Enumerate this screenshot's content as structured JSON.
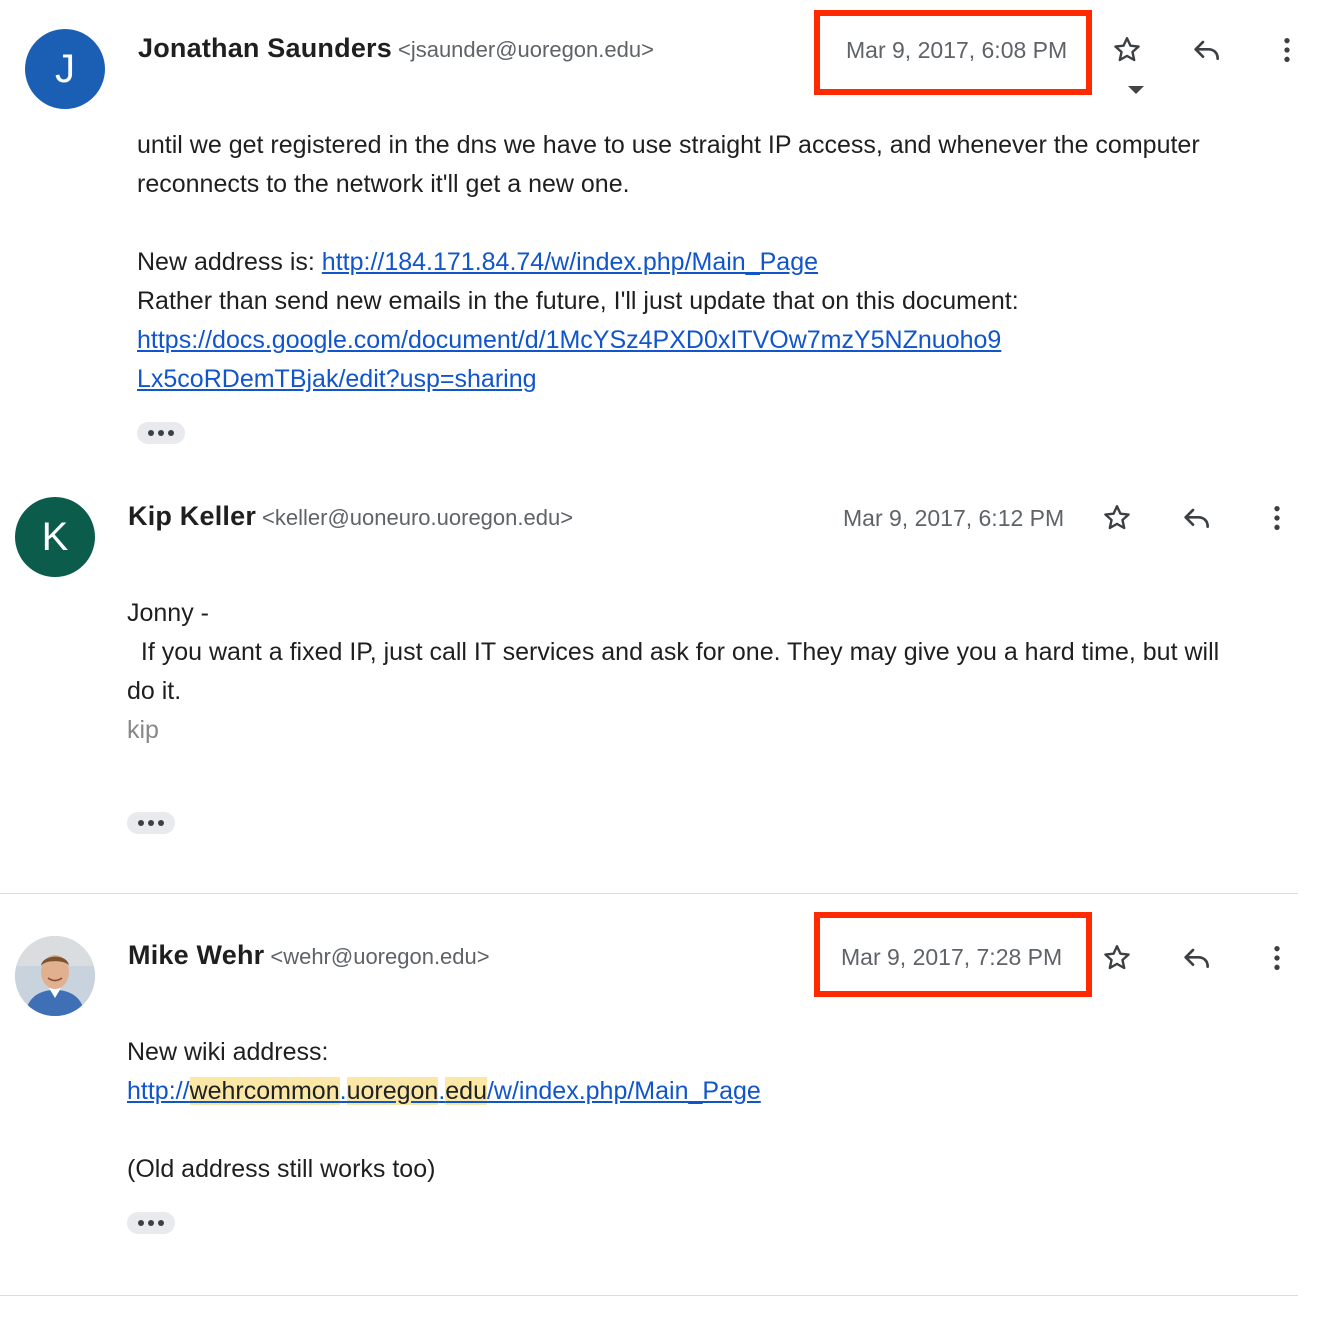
{
  "messages": [
    {
      "avatar_letter": "J",
      "avatar_color": "#1a5fb4",
      "sender_name": "Jonathan Saunders",
      "sender_email": "<jsaunder@uoregon.edu>",
      "date": "Mar 9, 2017, 6:08 PM",
      "date_highlighted": true,
      "body": {
        "line1": "until we get registered in the dns we have to use straight IP access, and whenever the computer",
        "line2": "reconnects to the network it'll get a new one.",
        "new_address_label": "New address is: ",
        "new_address_link": "http://184.171.84.74/w/index.php/Main_Page",
        "line4": "Rather than send new emails in the future, I'll just update that on this document:",
        "doc_link_part1": "https://docs.google.com/document/d/1McYSz4PXD0xITVOw7mzY5NZnuoho9",
        "doc_link_part2": "Lx5coRDemTBjak/edit?usp=sharing"
      }
    },
    {
      "avatar_letter": "K",
      "avatar_color": "#0b5c4a",
      "sender_name": "Kip Keller",
      "sender_email": "<keller@uoneuro.uoregon.edu>",
      "date": "Mar 9, 2017, 6:12 PM",
      "date_highlighted": false,
      "body": {
        "greeting": "Jonny -",
        "line2": "  If you want a fixed IP, just call IT services and ask for one. They may give you a hard time, but will",
        "line3": "do it.",
        "signature": "kip"
      }
    },
    {
      "avatar_icon": "user-photo",
      "sender_name": "Mike Wehr",
      "sender_email": "<wehr@uoregon.edu>",
      "date": "Mar 9, 2017, 7:28 PM",
      "date_highlighted": true,
      "body": {
        "line1": "New wiki address:",
        "link_prefix": "http://",
        "link_seg1": "wehrcommon",
        "link_dot1": ".",
        "link_seg2": "uoregon",
        "link_dot2": ".",
        "link_seg3": "edu",
        "link_suffix": "/w/index.php/Main_Page",
        "line3": "(Old address still works too)"
      }
    }
  ],
  "colors": {
    "highlight_box": "#ff2a00",
    "link": "#1155cc",
    "search_highlight": "#fce8a6"
  },
  "icons": [
    "star-icon",
    "reply-icon",
    "more-vert-icon",
    "ellipsis-icon"
  ]
}
